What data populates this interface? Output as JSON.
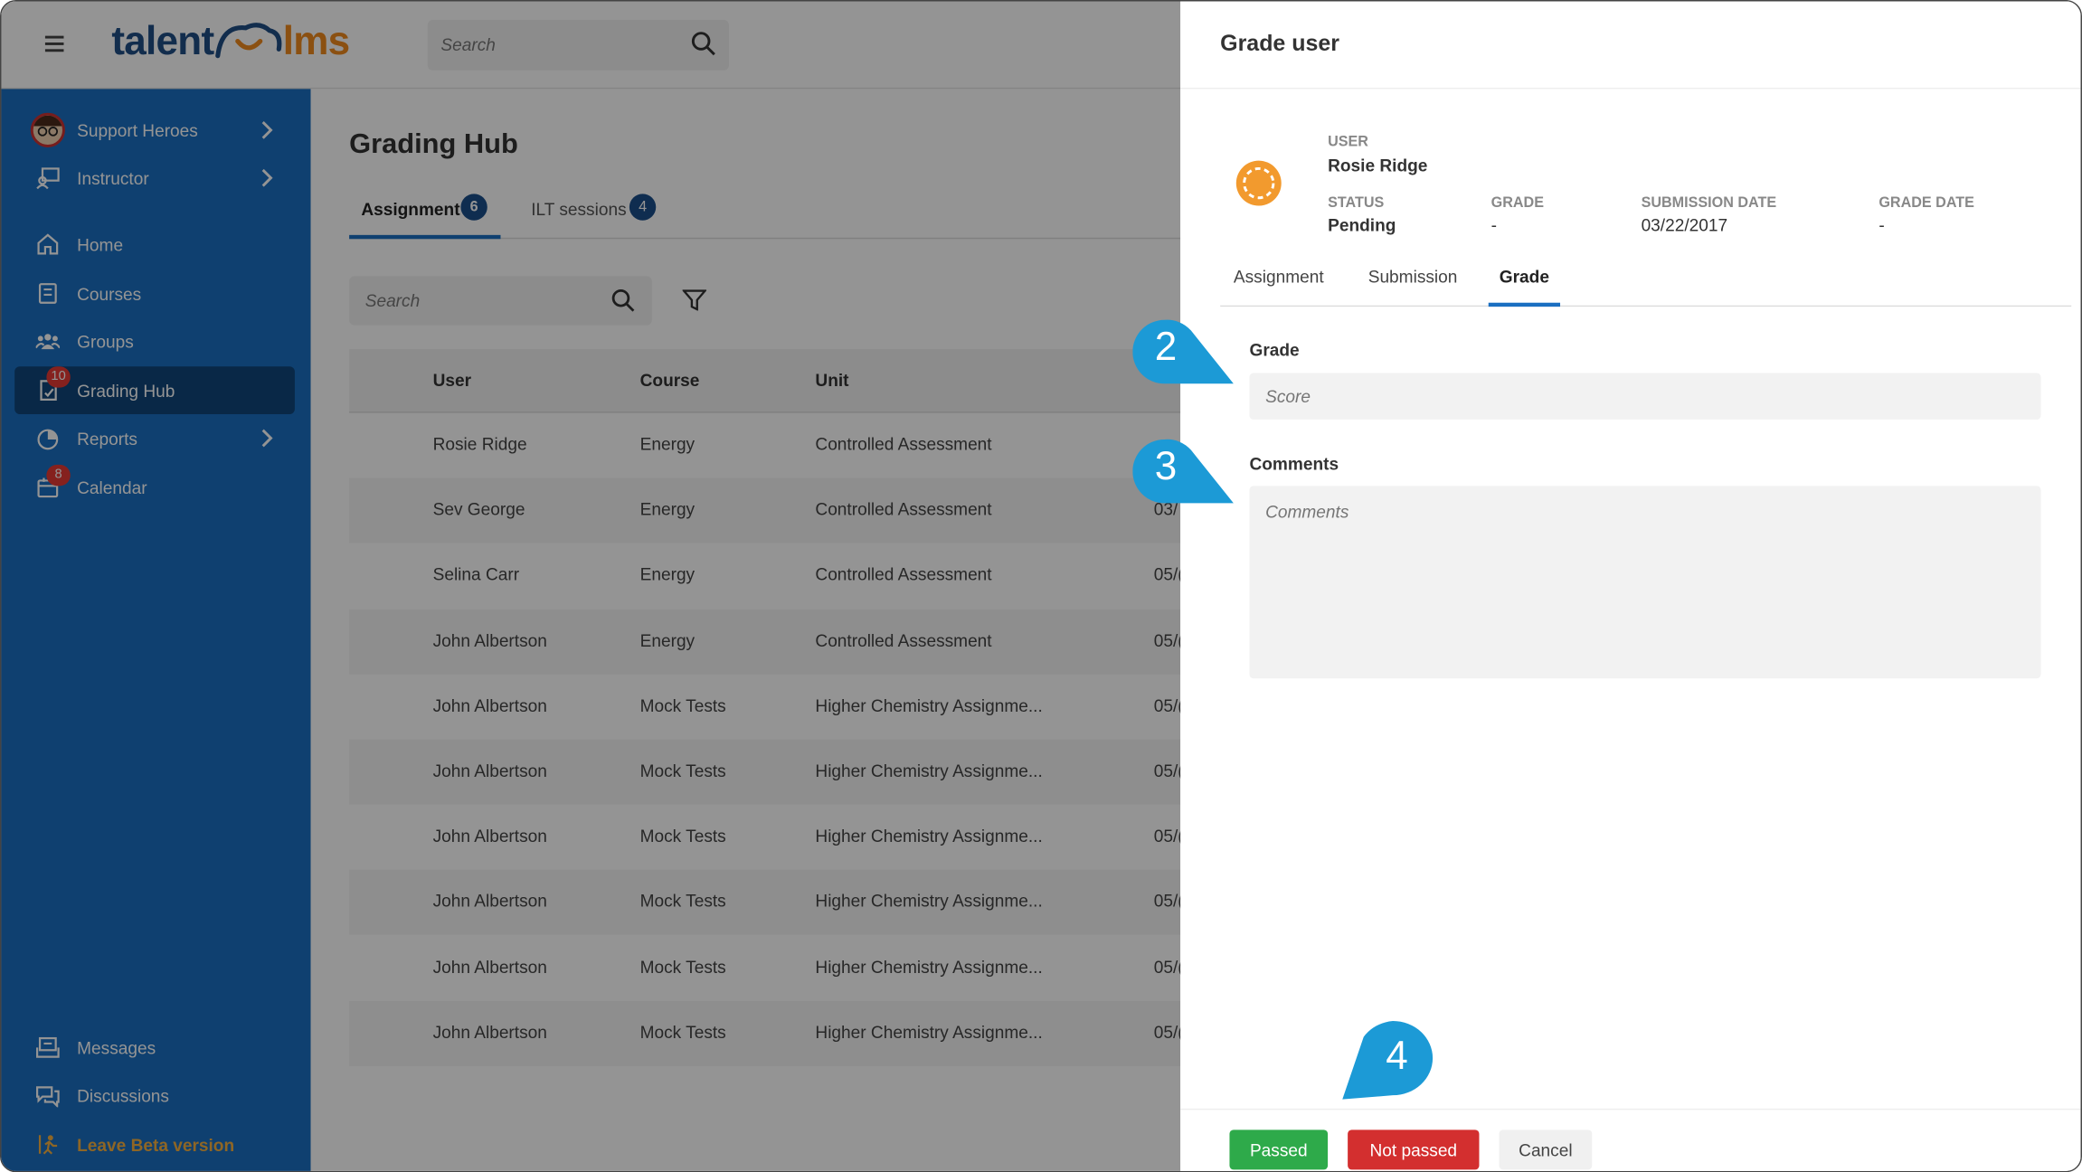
{
  "header": {
    "logo_left": "talent",
    "logo_right": "lms",
    "search_placeholder": "Search"
  },
  "sidebar": {
    "profile": {
      "label": "Support Heroes"
    },
    "role": {
      "label": "Instructor"
    },
    "items": [
      {
        "label": "Home"
      },
      {
        "label": "Courses"
      },
      {
        "label": "Groups"
      },
      {
        "label": "Grading Hub",
        "badge": "10"
      },
      {
        "label": "Reports"
      },
      {
        "label": "Calendar",
        "badge": "8"
      }
    ],
    "bottom": [
      {
        "label": "Messages"
      },
      {
        "label": "Discussions"
      },
      {
        "label": "Leave Beta version"
      }
    ]
  },
  "main": {
    "title": "Grading Hub",
    "tabs": [
      {
        "label": "Assignment",
        "count": "6"
      },
      {
        "label": "ILT sessions",
        "count": "4"
      }
    ],
    "search_placeholder": "Search",
    "columns": [
      "User",
      "Course",
      "Unit"
    ],
    "rows": [
      {
        "user": "Rosie Ridge",
        "course": "Energy",
        "unit": "Controlled Assessment",
        "date": ""
      },
      {
        "user": "Sev George",
        "course": "Energy",
        "unit": "Controlled Assessment",
        "date": "03/"
      },
      {
        "user": "Selina Carr",
        "course": "Energy",
        "unit": "Controlled Assessment",
        "date": "05/("
      },
      {
        "user": "John Albertson",
        "course": "Energy",
        "unit": "Controlled Assessment",
        "date": "05/("
      },
      {
        "user": "John Albertson",
        "course": "Mock Tests",
        "unit": "Higher Chemistry Assignme...",
        "date": "05/("
      },
      {
        "user": "John Albertson",
        "course": "Mock Tests",
        "unit": "Higher Chemistry Assignme...",
        "date": "05/("
      },
      {
        "user": "John Albertson",
        "course": "Mock Tests",
        "unit": "Higher Chemistry Assignme...",
        "date": "05/("
      },
      {
        "user": "John Albertson",
        "course": "Mock Tests",
        "unit": "Higher Chemistry Assignme...",
        "date": "05/("
      },
      {
        "user": "John Albertson",
        "course": "Mock Tests",
        "unit": "Higher Chemistry Assignme...",
        "date": "05/("
      },
      {
        "user": "John Albertson",
        "course": "Mock Tests",
        "unit": "Higher Chemistry Assignme...",
        "date": "05/("
      }
    ]
  },
  "panel": {
    "title": "Grade user",
    "user_label": "USER",
    "user_value": "Rosie Ridge",
    "status_label": "STATUS",
    "status_value": "Pending",
    "grade_label": "GRADE",
    "grade_value": "-",
    "submission_label": "SUBMISSION DATE",
    "submission_value": "03/22/2017",
    "gradedate_label": "GRADE DATE",
    "gradedate_value": "-",
    "tabs": [
      "Assignment",
      "Submission",
      "Grade"
    ],
    "grade_field_label": "Grade",
    "score_placeholder": "Score",
    "comments_label": "Comments",
    "comments_placeholder": "Comments",
    "buttons": {
      "passed": "Passed",
      "not_passed": "Not passed",
      "cancel": "Cancel"
    }
  },
  "callouts": [
    "2",
    "3",
    "4"
  ],
  "colors": {
    "sidebar": "#1b6fc1",
    "sidebar_active": "#10467a",
    "brand_orange": "#ef8a1e",
    "callout": "#1c9ad6",
    "passed": "#2eaa4a",
    "not_passed": "#d32f2f"
  }
}
